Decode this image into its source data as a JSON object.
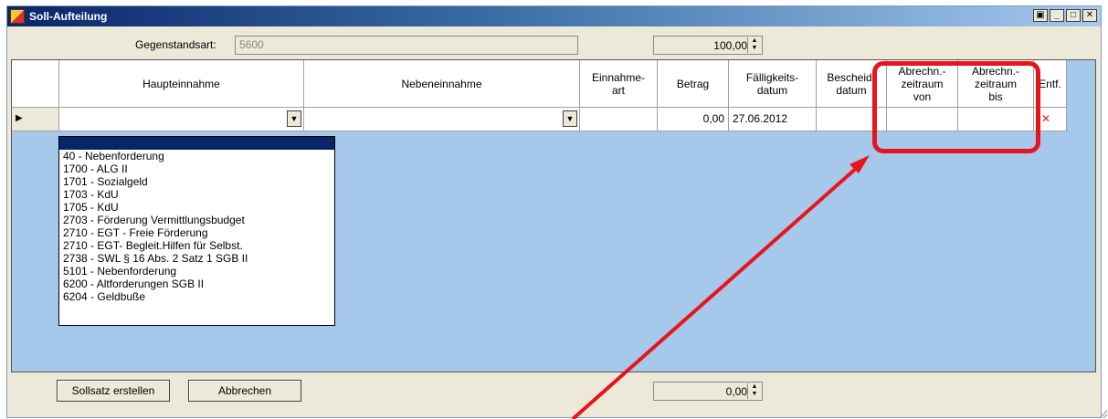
{
  "window": {
    "title": "Soll-Aufteilung"
  },
  "titlebar_buttons": [
    "print-icon",
    "minimize-icon",
    "maximize-icon",
    "close-icon"
  ],
  "form": {
    "gegenstandsart_label": "Gegenstandsart:",
    "gegenstandsart_value": "5600",
    "amount_top": "100,00",
    "amount_bottom": "0,00"
  },
  "grid": {
    "columns": [
      "Haupteinnahme",
      "Nebeneinnahme",
      "Einnahme-\nart",
      "Betrag",
      "Fälligkeits-\ndatum",
      "Bescheid-\ndatum",
      "Abrechn.-\nzeitraum\nvon",
      "Abrechn.-\nzeitraum\nbis",
      "Entf."
    ],
    "row": {
      "betrag": "0,00",
      "faelligkeitsdatum": "27.06.2012",
      "delete": "✕"
    }
  },
  "dropdown_items": [
    "40 - Nebenforderung",
    "1700 - ALG II",
    "1701 - Sozialgeld",
    "1703 - KdU",
    "1705 - KdU",
    "2703 - Förderung Vermittlungsbudget",
    "2710 - EGT - Freie Förderung",
    "2710 - EGT- Begleit.Hilfen für Selbst.",
    "2738 - SWL § 16 Abs. 2 Satz 1 SGB II",
    "5101 - Nebenforderung",
    "6200 - Altforderungen SGB II",
    "6204 - Geldbuße"
  ],
  "buttons": {
    "create": "Sollsatz erstellen",
    "cancel": "Abbrechen"
  },
  "colors": {
    "highlight": "#e8141c",
    "grid_bg": "#a6c8eb",
    "selection": "#0a246a"
  }
}
